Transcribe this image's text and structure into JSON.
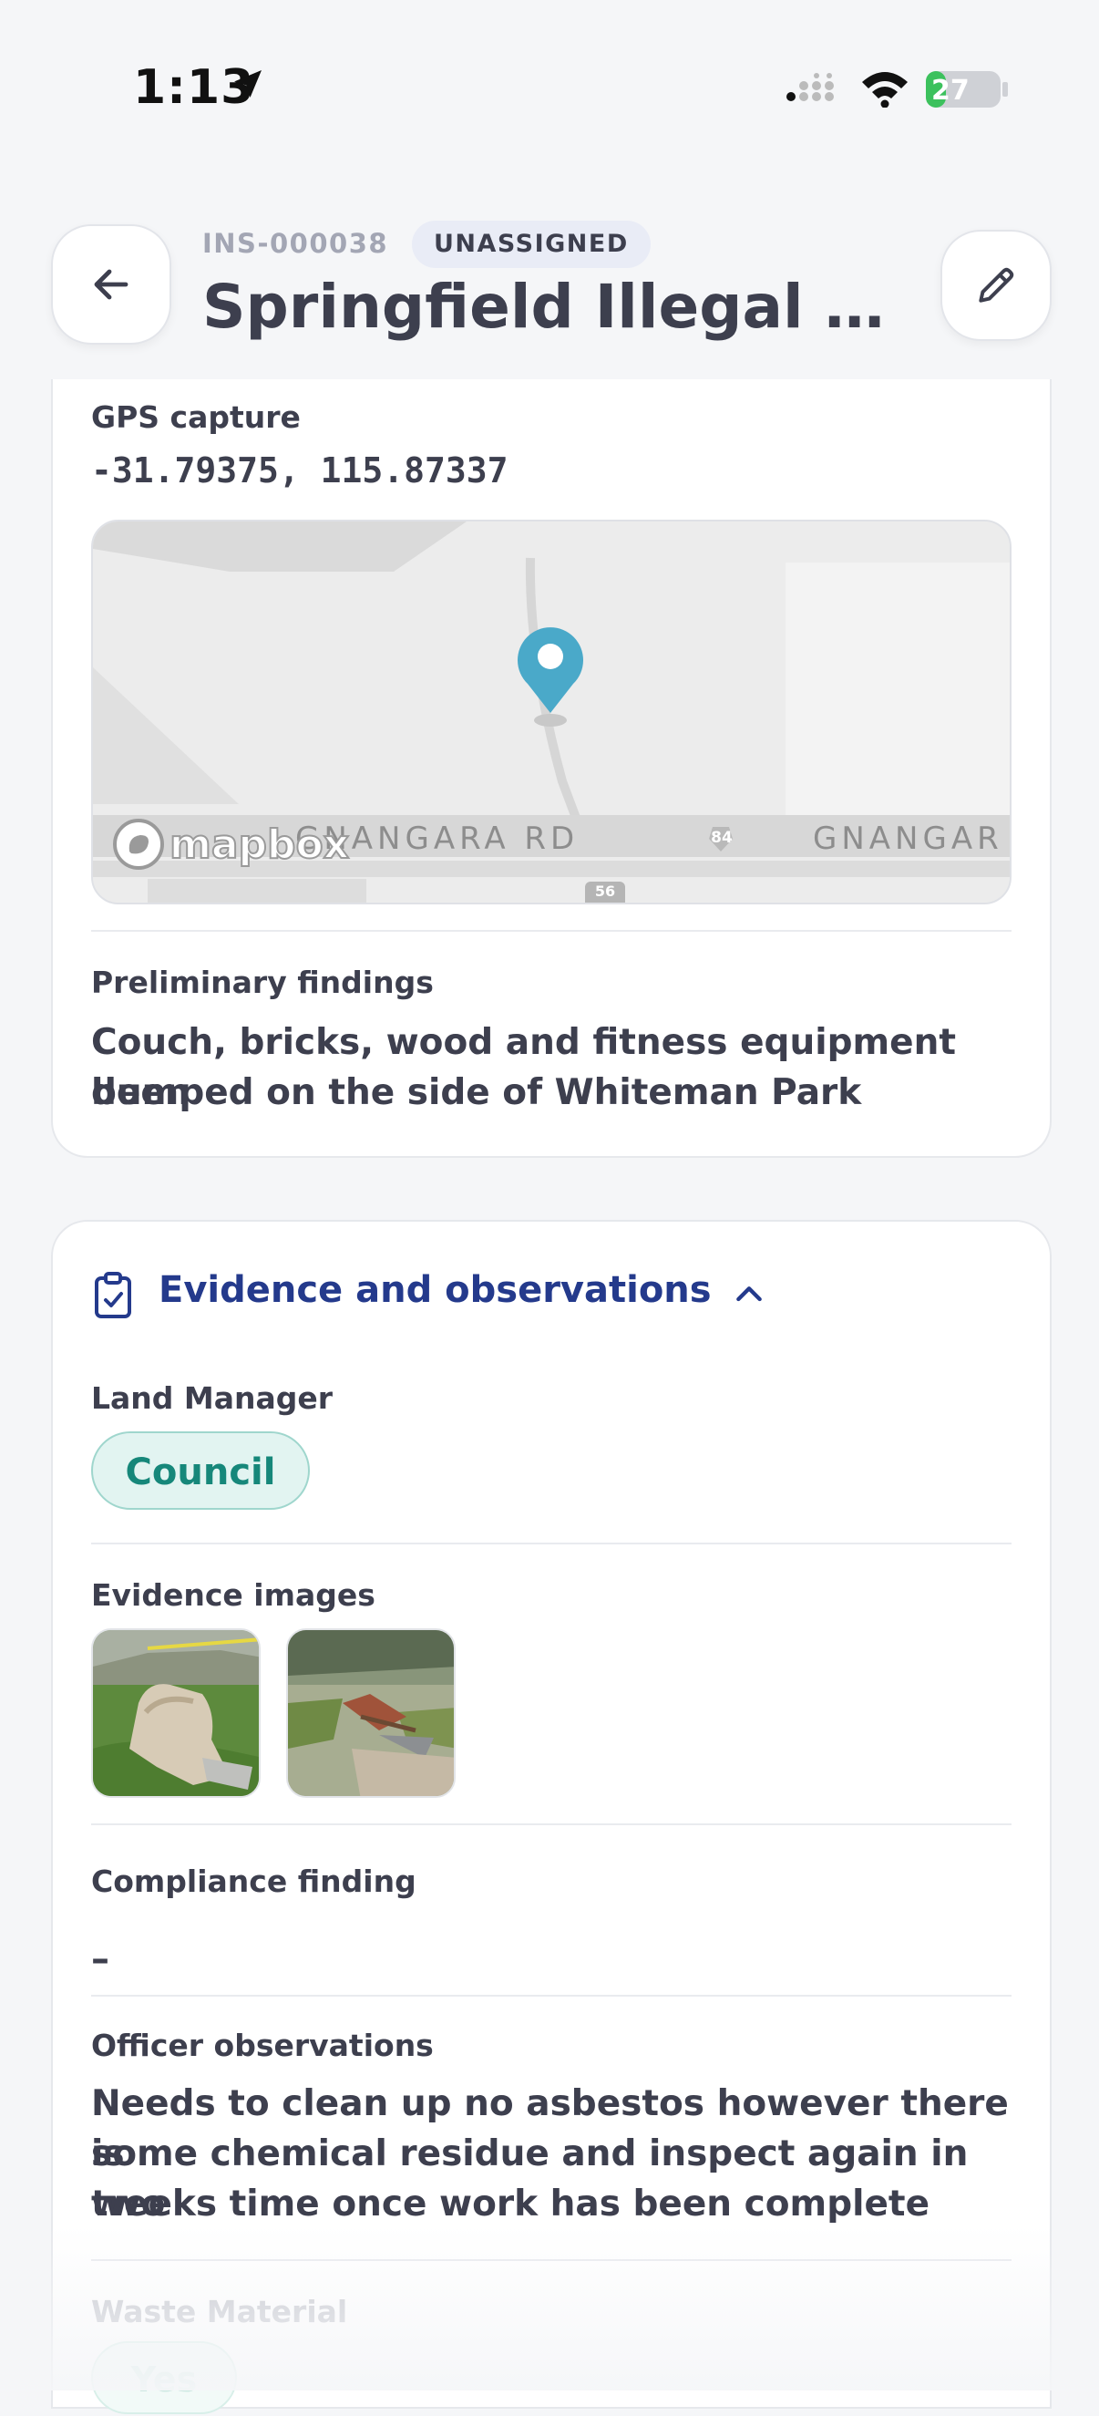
{
  "status_bar": {
    "time": "1:13",
    "battery": "27",
    "battery_level": 0.27,
    "icons": [
      "location-arrow-icon",
      "signal-icon",
      "wifi-icon",
      "battery-charging-icon"
    ]
  },
  "header": {
    "id": "INS-000038",
    "status": "UNASSIGNED",
    "title": "Springfield Illegal Du…",
    "back_icon": "arrow-left-icon",
    "edit_icon": "pencil-icon"
  },
  "location_card": {
    "gps_label": "GPS capture",
    "gps_value": "-31.79375, 115.87337",
    "map": {
      "road_label_left": "GNANGARA RD",
      "road_label_right": "GNANGAR",
      "route_shield": "84",
      "route_shield_2": "56",
      "attribution": "mapbox",
      "marker_color": "#4aa9c9"
    },
    "findings_label": "Preliminary findings",
    "findings_line1": "Couch, bricks, wood and fitness equipment been",
    "findings_line2": "dumped on the side of Whiteman Park"
  },
  "evidence_card": {
    "title": "Evidence and observations",
    "icon": "clipboard-check-icon",
    "toggle_icon": "chevron-up-icon",
    "land_manager_label": "Land Manager",
    "land_manager_value": "Council",
    "images_label": "Evidence images",
    "compliance_label": "Compliance finding",
    "compliance_value": "–",
    "observations_label": "Officer observations",
    "observations_line1": "Needs to clean up no asbestos however there is",
    "observations_line2": "some chemical residue and inspect again in two",
    "observations_line3": "weeks time once work has been complete",
    "waste_label": "Waste Material",
    "waste_value": "Yes"
  },
  "colors": {
    "accent_blue": "#243a8c",
    "council_teal": "#16877a",
    "marker": "#4aa9c9"
  }
}
